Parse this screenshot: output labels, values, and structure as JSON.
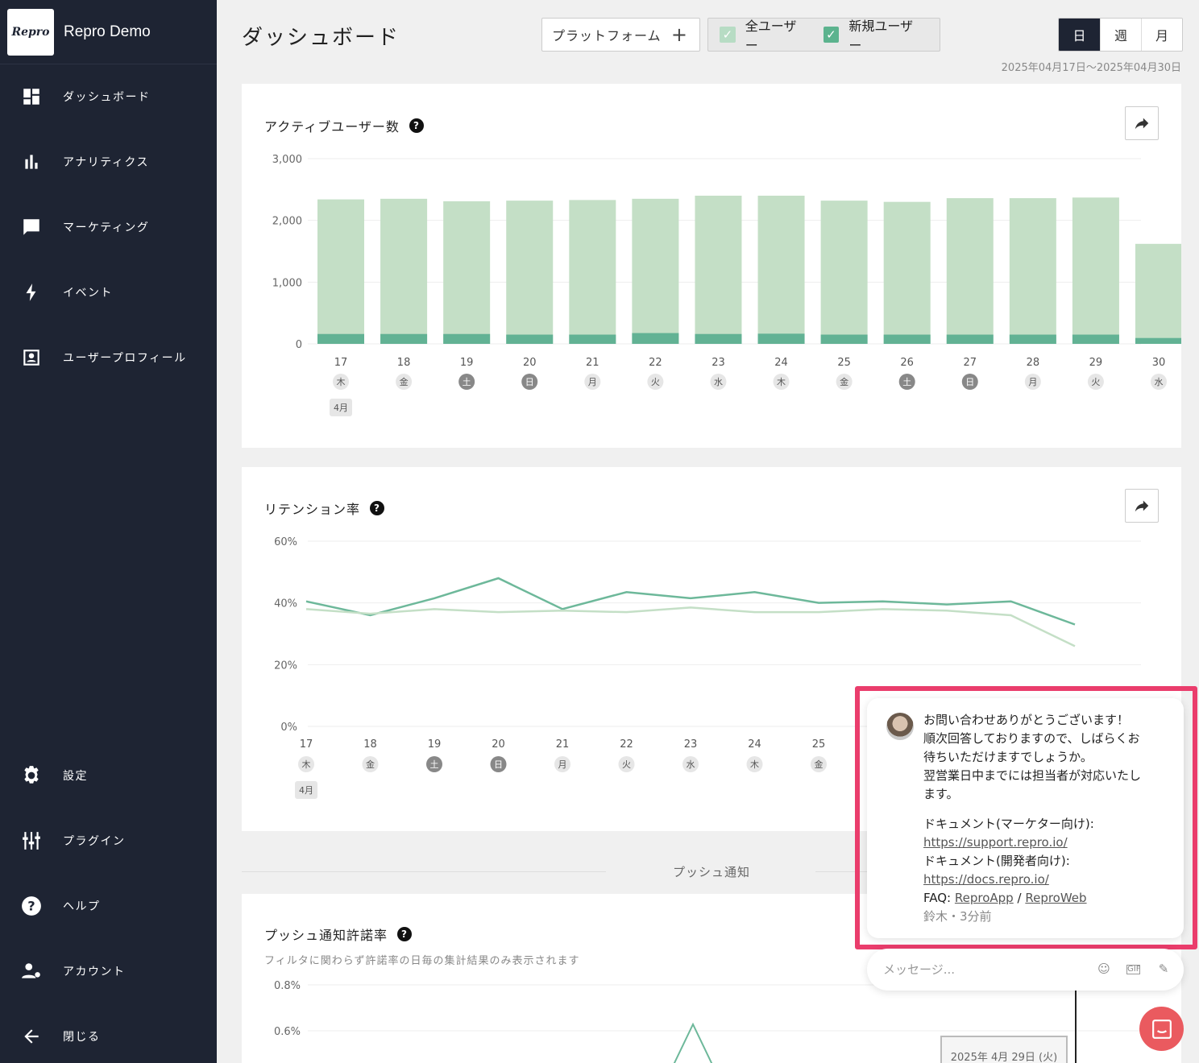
{
  "brand": {
    "logo_text": "Repro",
    "app_name": "Repro Demo"
  },
  "sidebar": {
    "items": [
      {
        "label": "ダッシュボード",
        "icon": "dashboard-icon"
      },
      {
        "label": "アナリティクス",
        "icon": "bar-chart-icon"
      },
      {
        "label": "マーケティング",
        "icon": "message-icon"
      },
      {
        "label": "イベント",
        "icon": "bolt-icon"
      },
      {
        "label": "ユーザープロフィール",
        "icon": "profile-icon"
      }
    ],
    "bottom_items": [
      {
        "label": "設定",
        "icon": "gear-icon"
      },
      {
        "label": "プラグイン",
        "icon": "plugin-icon"
      },
      {
        "label": "ヘルプ",
        "icon": "help-icon"
      },
      {
        "label": "アカウント",
        "icon": "account-icon"
      },
      {
        "label": "閉じる",
        "icon": "arrow-left-icon"
      }
    ]
  },
  "header": {
    "title": "ダッシュボード",
    "platform_button": "プラットフォーム",
    "filters": {
      "all_users": "全ユーザー",
      "new_users": "新規ユーザー"
    },
    "period": {
      "day": "日",
      "week": "週",
      "month": "月",
      "selected": "日"
    },
    "date_range": "2025年04月17日〜2025年04月30日"
  },
  "active_users_card": {
    "title": "アクティブユーザー数",
    "help": "?",
    "month_badge": "4月"
  },
  "retention_card": {
    "title": "リテンション率",
    "help": "?",
    "month_badge": "4月"
  },
  "push_section": {
    "divider_label": "プッシュ通知",
    "title": "プッシュ通知許諾率",
    "help": "?",
    "subtitle": "フィルタに関わらず許諾率の日毎の集計結果のみ表示されます",
    "tooltip": "2025年 4月 29日 (火)"
  },
  "chat": {
    "lines": [
      "お問い合わせありがとうございます！",
      "順次回答しておりますので、しばらくお",
      "待ちいただけますでしょうか。",
      "翌営業日中までには担当者が対応いたし",
      "ます。"
    ],
    "doc_marketer_label": "ドキュメント(マーケター向け):",
    "doc_marketer_url": "https://support.repro.io/",
    "doc_dev_label": "ドキュメント(開発者向け):",
    "doc_dev_url": "https://docs.repro.io/",
    "faq_label": "FAQ:",
    "faq_link_app": "ReproApp",
    "faq_separator": "/",
    "faq_link_web": "ReproWeb",
    "meta": "鈴木・3分前",
    "input_placeholder": "メッセージ..."
  },
  "chart_data": [
    {
      "type": "bar",
      "title": "アクティブユーザー数",
      "categories": [
        "17",
        "18",
        "19",
        "20",
        "21",
        "22",
        "23",
        "24",
        "25",
        "26",
        "27",
        "28",
        "29",
        "30"
      ],
      "weekdays": [
        "木",
        "金",
        "土",
        "日",
        "月",
        "火",
        "水",
        "木",
        "金",
        "土",
        "日",
        "月",
        "火",
        "水"
      ],
      "series": [
        {
          "name": "全ユーザー",
          "values": [
            2340,
            2350,
            2310,
            2320,
            2330,
            2350,
            2400,
            2400,
            2320,
            2300,
            2360,
            2360,
            2370,
            1620
          ]
        },
        {
          "name": "新規ユーザー",
          "values": [
            160,
            160,
            160,
            150,
            150,
            175,
            160,
            165,
            150,
            150,
            150,
            150,
            150,
            95
          ]
        }
      ],
      "ylim": [
        0,
        3000
      ],
      "yticks": [
        "0",
        "1,000",
        "2,000",
        "3,000"
      ],
      "colors": {
        "all": "#c4dfc6",
        "new": "#62b294"
      }
    },
    {
      "type": "line",
      "title": "リテンション率",
      "categories": [
        "17",
        "18",
        "19",
        "20",
        "21",
        "22",
        "23",
        "24",
        "25"
      ],
      "weekdays": [
        "木",
        "金",
        "土",
        "日",
        "月",
        "火",
        "水",
        "木",
        "金"
      ],
      "x": [
        17,
        18,
        19,
        20,
        21,
        22,
        23,
        24,
        25,
        26,
        27,
        28,
        29,
        30
      ],
      "series": [
        {
          "name": "新規ユーザー",
          "values": [
            40.5,
            36,
            41.5,
            48,
            38,
            43.5,
            41.5,
            43.5,
            40,
            40.5,
            39.5,
            40.5,
            33,
            null
          ]
        },
        {
          "name": "全ユーザー",
          "values": [
            38,
            36.5,
            38,
            37,
            37.5,
            37,
            38.5,
            37,
            37,
            38,
            37.5,
            36,
            26,
            null
          ]
        }
      ],
      "ylim": [
        0,
        60
      ],
      "yticks": [
        "0%",
        "20%",
        "40%",
        "60%"
      ],
      "colors": {
        "new": "#6db89a",
        "all": "#c4dfc6"
      }
    },
    {
      "type": "line",
      "title": "プッシュ通知許諾率",
      "yticks": [
        "0.6%",
        "0.8%"
      ],
      "colors": {
        "line": "#6db89a"
      }
    }
  ]
}
